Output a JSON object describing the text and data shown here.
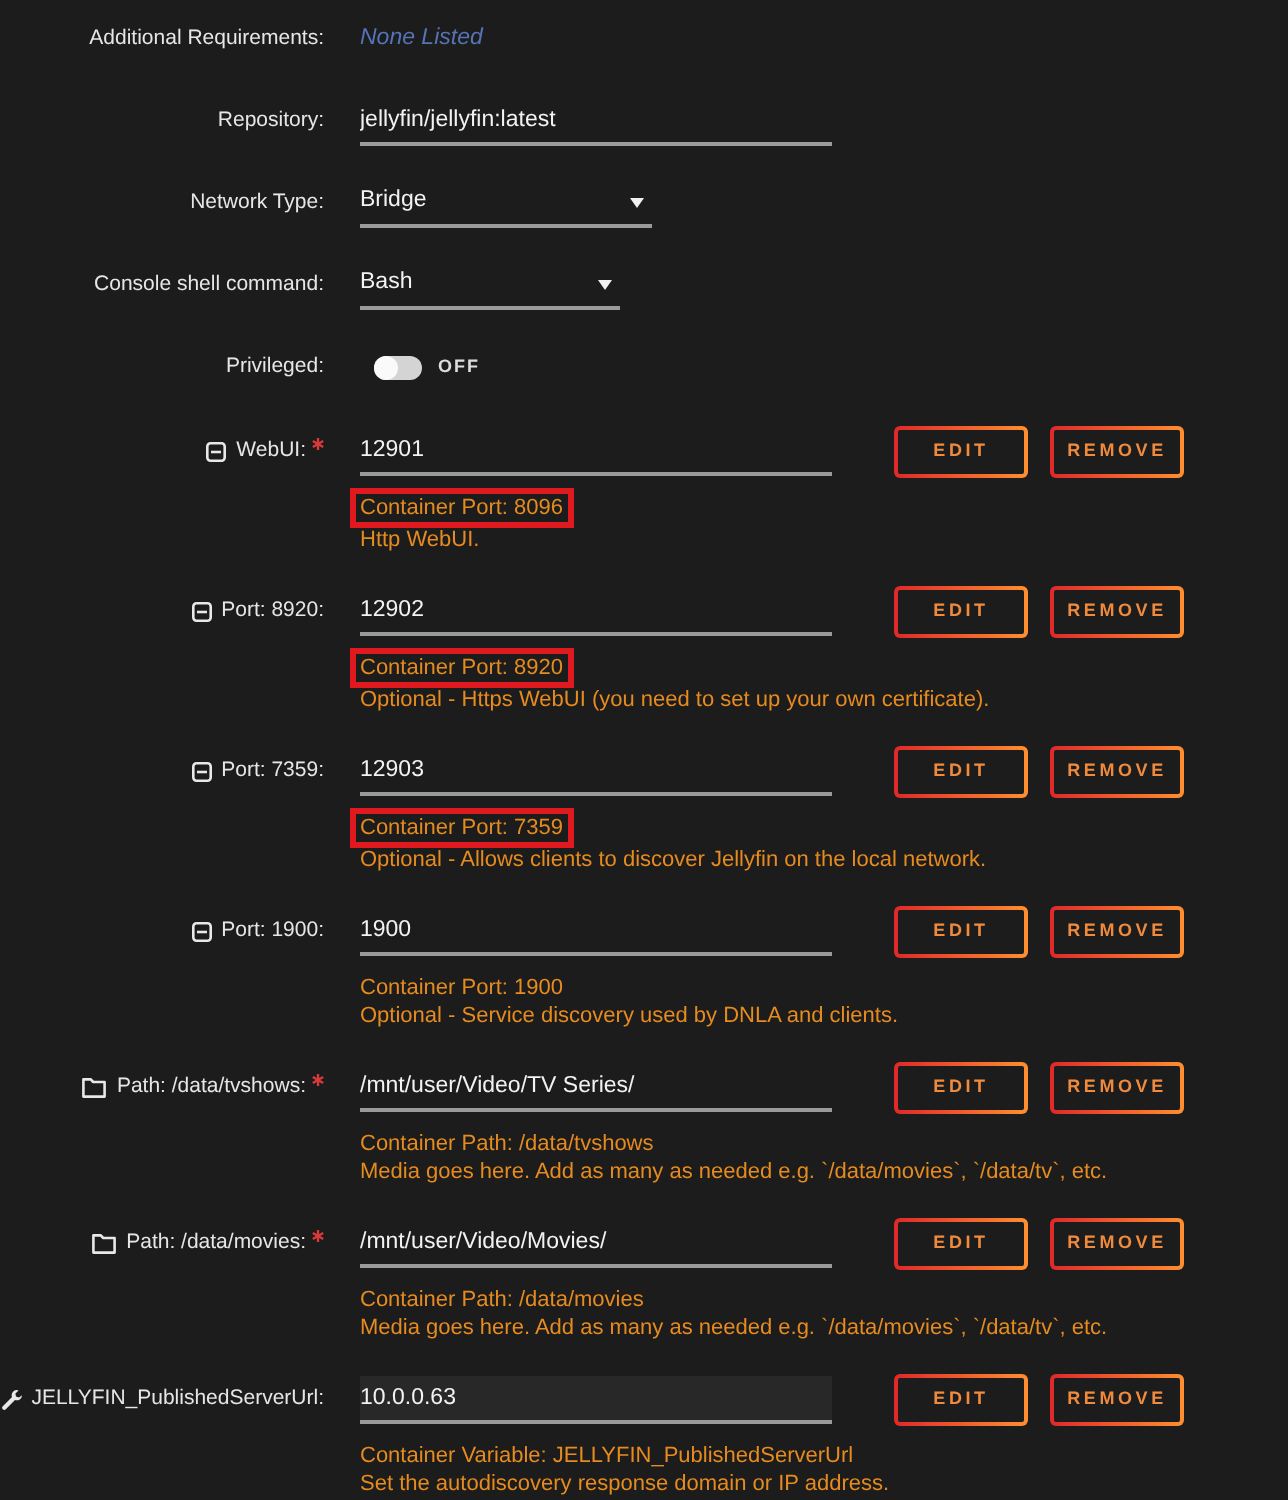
{
  "settings": [
    {
      "kind": "text",
      "label": "Additional Requirements:",
      "value": "None Listed"
    },
    {
      "kind": "input",
      "label": "Repository:",
      "value": "jellyfin/jellyfin:latest"
    },
    {
      "kind": "select",
      "label": "Network Type:",
      "value": "Bridge"
    },
    {
      "kind": "select",
      "label": "Console shell command:",
      "value": "Bash"
    },
    {
      "kind": "toggle",
      "label": "Privileged:",
      "on": false,
      "state_label": "OFF"
    }
  ],
  "configs": [
    {
      "kind": "port",
      "label": "WebUI:",
      "required": true,
      "value": "12901",
      "focused": false,
      "buttons": [
        "EDIT",
        "REMOVE"
      ],
      "details": [
        {
          "text": "Container Port: 8096",
          "highlighted": true
        },
        {
          "text": "Http WebUI.",
          "highlighted": false
        }
      ]
    },
    {
      "kind": "port",
      "label": "Port: 8920:",
      "required": false,
      "value": "12902",
      "focused": false,
      "buttons": [
        "EDIT",
        "REMOVE"
      ],
      "details": [
        {
          "text": "Container Port: 8920",
          "highlighted": true
        },
        {
          "text": "Optional - Https WebUI (you need to set up your own certificate).",
          "highlighted": false
        }
      ]
    },
    {
      "kind": "port",
      "label": "Port: 7359:",
      "required": false,
      "value": "12903",
      "focused": false,
      "buttons": [
        "EDIT",
        "REMOVE"
      ],
      "details": [
        {
          "text": "Container Port: 7359",
          "highlighted": true
        },
        {
          "text": "Optional - Allows clients to discover Jellyfin on the local network.",
          "highlighted": false
        }
      ]
    },
    {
      "kind": "port",
      "label": "Port: 1900:",
      "required": false,
      "value": "1900",
      "focused": false,
      "buttons": [
        "EDIT",
        "REMOVE"
      ],
      "details": [
        {
          "text": "Container Port: 1900",
          "highlighted": false
        },
        {
          "text": "Optional - Service discovery used by DNLA and clients.",
          "highlighted": false
        }
      ]
    },
    {
      "kind": "path",
      "label": "Path: /data/tvshows:",
      "required": true,
      "value": "/mnt/user/Video/TV Series/",
      "focused": false,
      "buttons": [
        "EDIT",
        "REMOVE"
      ],
      "details": [
        {
          "text": "Container Path: /data/tvshows",
          "highlighted": false
        },
        {
          "text": "Media goes here. Add as many as needed e.g. `/data/movies`, `/data/tv`, etc.",
          "highlighted": false
        }
      ]
    },
    {
      "kind": "path",
      "label": "Path: /data/movies:",
      "required": true,
      "value": "/mnt/user/Video/Movies/",
      "focused": false,
      "buttons": [
        "EDIT",
        "REMOVE"
      ],
      "details": [
        {
          "text": "Container Path: /data/movies",
          "highlighted": false
        },
        {
          "text": "Media goes here. Add as many as needed e.g. `/data/movies`, `/data/tv`, etc.",
          "highlighted": false
        }
      ]
    },
    {
      "kind": "variable",
      "label": "JELLYFIN_PublishedServerUrl:",
      "required": false,
      "value": "10.0.0.63",
      "focused": true,
      "buttons": [
        "EDIT",
        "REMOVE"
      ],
      "details": [
        {
          "text": "Container Variable: JELLYFIN_PublishedServerUrl",
          "highlighted": false
        },
        {
          "text": "Set the autodiscovery response domain or IP address.",
          "highlighted": false
        }
      ]
    }
  ]
}
